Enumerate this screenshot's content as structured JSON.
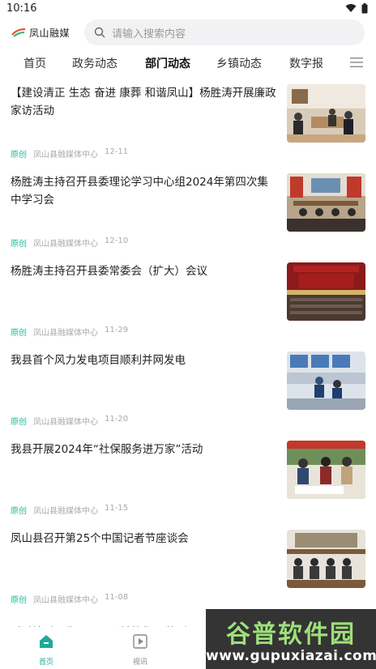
{
  "status_bar": {
    "time": "10:16"
  },
  "header": {
    "logo_text": "凤山融媒",
    "search_placeholder": "请输入搜索内容"
  },
  "nav": {
    "tabs": [
      "首页",
      "政务动态",
      "部门动态",
      "乡镇动态",
      "数字报"
    ],
    "active": "部门动态"
  },
  "feed": [
    {
      "title": "【建设清正 生态 奋进 康葬 和谐凤山】杨胜涛开展廉政家访活动",
      "tag": "原创",
      "source": "凤山县融媒体中心",
      "date": "12-11"
    },
    {
      "title": "杨胜涛主持召开县委理论学习中心组2024年第四次集中学习会",
      "tag": "原创",
      "source": "凤山县融媒体中心",
      "date": "12-10"
    },
    {
      "title": "杨胜涛主持召开县委常委会（扩大）会议",
      "tag": "原创",
      "source": "凤山县融媒体中心",
      "date": "11-29"
    },
    {
      "title": "我县首个风力发电项目顺利并网发电",
      "tag": "原创",
      "source": "凤山县融媒体中心",
      "date": "11-20"
    },
    {
      "title": "我县开展2024年“社保服务进万家”活动",
      "tag": "原创",
      "source": "凤山县融媒体中心",
      "date": "11-15"
    },
    {
      "title": "凤山县召开第25个中国记者节座谈会",
      "tag": "原创",
      "source": "凤山县融媒体中心",
      "date": "11-08"
    }
  ],
  "partial_item": {
    "title": "时过境迁，你不再是从前的你 #热烈"
  },
  "bottom_nav": {
    "home": "首页",
    "video": "视讯"
  },
  "watermark": {
    "title": "谷普软件园",
    "url": "www.gupuxiazai.com"
  },
  "colors": {
    "accent": "#1fa99a",
    "tag": "#1abc9c"
  }
}
